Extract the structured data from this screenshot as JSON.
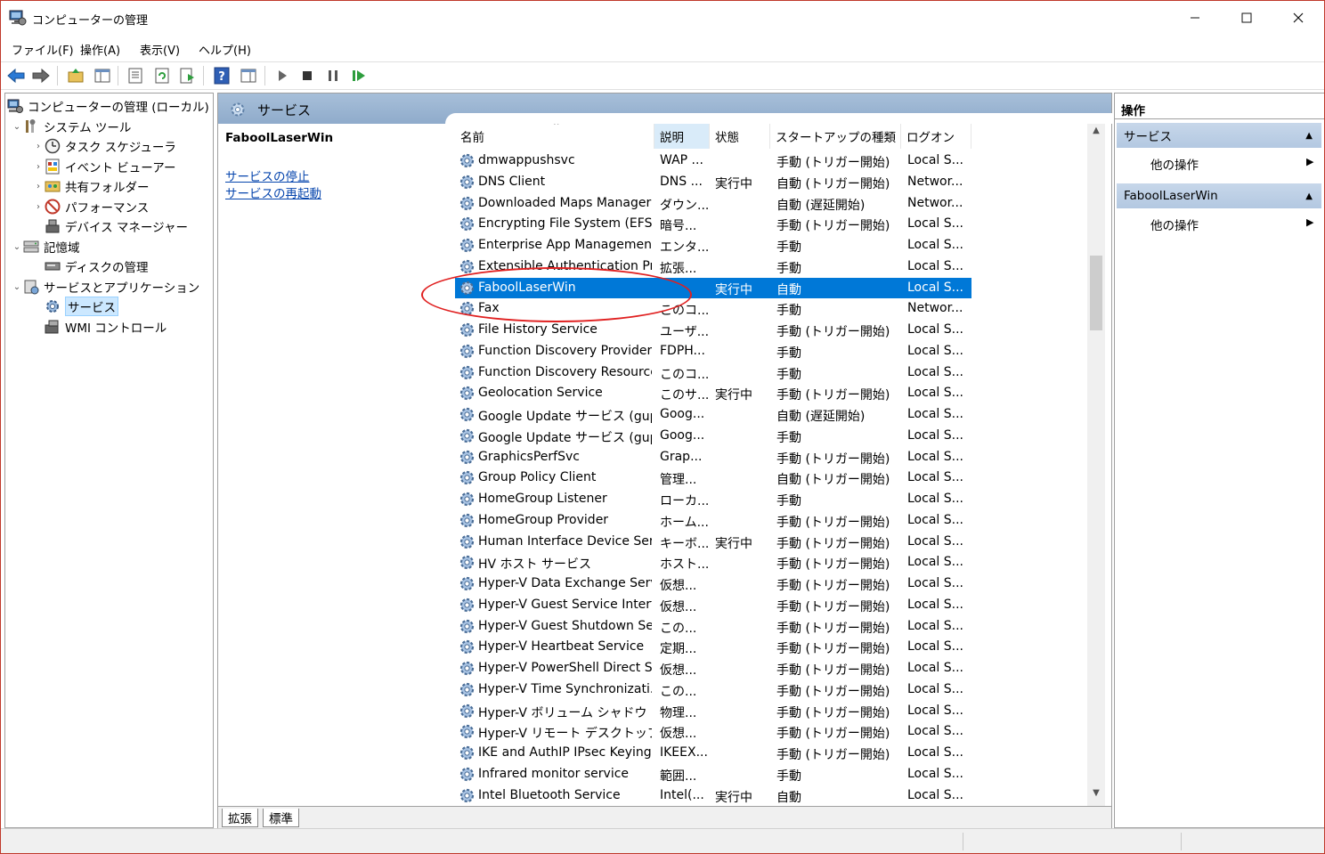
{
  "window": {
    "title": "コンピューターの管理"
  },
  "menu": [
    "ファイル(F)",
    "操作(A)",
    "表示(V)",
    "ヘルプ(H)"
  ],
  "tree": [
    {
      "label": "コンピューターの管理 (ローカル)",
      "level": 0,
      "expander": "",
      "icon": "computer-management-icon"
    },
    {
      "label": "システム ツール",
      "level": 1,
      "expander": "⌄",
      "icon": "system-tools-icon"
    },
    {
      "label": "タスク スケジューラ",
      "level": 2,
      "expander": "›",
      "icon": "clock-icon"
    },
    {
      "label": "イベント ビューアー",
      "level": 2,
      "expander": "›",
      "icon": "event-viewer-icon"
    },
    {
      "label": "共有フォルダー",
      "level": 2,
      "expander": "›",
      "icon": "shared-folder-icon"
    },
    {
      "label": "パフォーマンス",
      "level": 2,
      "expander": "›",
      "icon": "performance-icon"
    },
    {
      "label": "デバイス マネージャー",
      "level": 2,
      "expander": "",
      "icon": "device-manager-icon"
    },
    {
      "label": "記憶域",
      "level": 1,
      "expander": "⌄",
      "icon": "storage-icon"
    },
    {
      "label": "ディスクの管理",
      "level": 2,
      "expander": "",
      "icon": "disk-management-icon"
    },
    {
      "label": "サービスとアプリケーション",
      "level": 1,
      "expander": "⌄",
      "icon": "services-apps-icon"
    },
    {
      "label": "サービス",
      "level": 2,
      "expander": "",
      "icon": "services-gear-icon",
      "selected": true
    },
    {
      "label": "WMI コントロール",
      "level": 2,
      "expander": "",
      "icon": "wmi-icon"
    }
  ],
  "center": {
    "title": "サービス",
    "selected_service": "FaboolLaserWin",
    "links": [
      "サービスの停止",
      "サービスの再起動"
    ],
    "columns": [
      "名前",
      "説明",
      "状態",
      "スタートアップの種類",
      "ログオン"
    ],
    "rows": [
      [
        "dmwappushsvc",
        "WAP ...",
        "",
        "手動 (トリガー開始)",
        "Local S..."
      ],
      [
        "DNS Client",
        "DNS ...",
        "実行中",
        "自動 (トリガー開始)",
        "Networ..."
      ],
      [
        "Downloaded Maps Manager",
        "ダウン...",
        "",
        "自動 (遅延開始)",
        "Networ..."
      ],
      [
        "Encrypting File System (EFS)",
        "暗号...",
        "",
        "手動 (トリガー開始)",
        "Local S..."
      ],
      [
        "Enterprise App Managemen...",
        "エンタ...",
        "",
        "手動",
        "Local S..."
      ],
      [
        "Extensible Authentication Pr...",
        "拡張...",
        "",
        "手動",
        "Local S..."
      ],
      [
        "FaboolLaserWin",
        "",
        "実行中",
        "自動",
        "Local S..."
      ],
      [
        "Fax",
        "このコ...",
        "",
        "手動",
        "Networ..."
      ],
      [
        "File History Service",
        "ユーザ...",
        "",
        "手動 (トリガー開始)",
        "Local S..."
      ],
      [
        "Function Discovery Provider ...",
        "FDPH...",
        "",
        "手動",
        "Local S..."
      ],
      [
        "Function Discovery Resource...",
        "このコ...",
        "",
        "手動",
        "Local S..."
      ],
      [
        "Geolocation Service",
        "このサ...",
        "実行中",
        "手動 (トリガー開始)",
        "Local S..."
      ],
      [
        "Google Update サービス (gup...",
        "Goog...",
        "",
        "自動 (遅延開始)",
        "Local S..."
      ],
      [
        "Google Update サービス (gup...",
        "Goog...",
        "",
        "手動",
        "Local S..."
      ],
      [
        "GraphicsPerfSvc",
        "Grap...",
        "",
        "手動 (トリガー開始)",
        "Local S..."
      ],
      [
        "Group Policy Client",
        "管理...",
        "",
        "自動 (トリガー開始)",
        "Local S..."
      ],
      [
        "HomeGroup Listener",
        "ローカ...",
        "",
        "手動",
        "Local S..."
      ],
      [
        "HomeGroup Provider",
        "ホーム...",
        "",
        "手動 (トリガー開始)",
        "Local S..."
      ],
      [
        "Human Interface Device Serv...",
        "キーボ...",
        "実行中",
        "手動 (トリガー開始)",
        "Local S..."
      ],
      [
        "HV ホスト サービス",
        "ホスト...",
        "",
        "手動 (トリガー開始)",
        "Local S..."
      ],
      [
        "Hyper-V Data Exchange Serv...",
        "仮想...",
        "",
        "手動 (トリガー開始)",
        "Local S..."
      ],
      [
        "Hyper-V Guest Service Interf...",
        "仮想...",
        "",
        "手動 (トリガー開始)",
        "Local S..."
      ],
      [
        "Hyper-V Guest Shutdown Se...",
        "この...",
        "",
        "手動 (トリガー開始)",
        "Local S..."
      ],
      [
        "Hyper-V Heartbeat Service",
        "定期...",
        "",
        "手動 (トリガー開始)",
        "Local S..."
      ],
      [
        "Hyper-V PowerShell Direct S...",
        "仮想...",
        "",
        "手動 (トリガー開始)",
        "Local S..."
      ],
      [
        "Hyper-V Time Synchronizati...",
        "この...",
        "",
        "手動 (トリガー開始)",
        "Local S..."
      ],
      [
        "Hyper-V ボリューム シャドウ コピ...",
        "物理...",
        "",
        "手動 (トリガー開始)",
        "Local S..."
      ],
      [
        "Hyper-V リモート デスクトップ仮...",
        "仮想...",
        "",
        "手動 (トリガー開始)",
        "Local S..."
      ],
      [
        "IKE and AuthIP IPsec Keying ...",
        "IKEEX...",
        "",
        "手動 (トリガー開始)",
        "Local S..."
      ],
      [
        "Infrared monitor service",
        "範囲...",
        "",
        "手動",
        "Local S..."
      ],
      [
        "Intel Bluetooth Service",
        "Intel(...",
        "実行中",
        "自動",
        "Local S..."
      ]
    ],
    "selected_index": 6,
    "tabs": [
      "拡張",
      "標準"
    ]
  },
  "actions": {
    "title": "操作",
    "sections": [
      {
        "label": "サービス",
        "items": [
          "他の操作"
        ]
      },
      {
        "label": "FaboolLaserWin",
        "items": [
          "他の操作"
        ]
      }
    ]
  },
  "colors": {
    "selection": "#0078d7",
    "header": "#a7bfd9",
    "annotation": "#e02020"
  }
}
